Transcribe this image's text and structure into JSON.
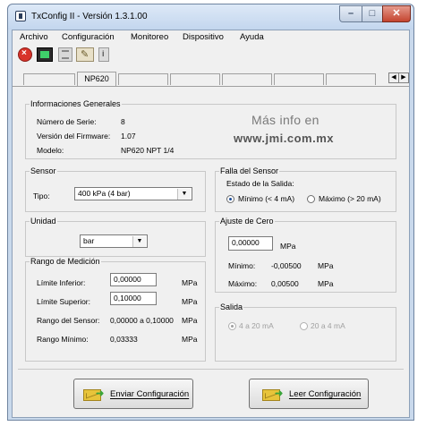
{
  "window": {
    "title": "TxConfig II - Versión 1.3.1.00"
  },
  "menu": [
    "Archivo",
    "Configuración",
    "Monitoreo",
    "Dispositivo",
    "Ayuda"
  ],
  "tabs": {
    "active": "NP620"
  },
  "info": {
    "group": "Informaciones Generales",
    "serial_label": "Número de Serie:",
    "serial": "8",
    "firmware_label": "Versión del Firmware:",
    "firmware": "1.07",
    "model_label": "Modelo:",
    "model": "NP620 NPT 1/4",
    "promo_line1": "Más info en",
    "promo_line2": "www.jmi.com.mx"
  },
  "sensor": {
    "group": "Sensor",
    "type_label": "Tipo:",
    "type_value": "400 kPa (4 bar)"
  },
  "fault": {
    "group": "Falla del Sensor",
    "output_state_label": "Estado de la Salida:",
    "min_option": "Mínimo (< 4 mA)",
    "max_option": "Máximo (> 20 mA)",
    "selected": "min"
  },
  "unit": {
    "group": "Unidad",
    "value": "bar"
  },
  "zero": {
    "group": "Ajuste de Cero",
    "value": "0,00000",
    "unit": "MPa",
    "min_label": "Mínimo:",
    "min_value": "-0,00500",
    "min_unit": "MPa",
    "max_label": "Máximo:",
    "max_value": "0,00500",
    "max_unit": "MPa"
  },
  "range": {
    "group": "Rango de Medición",
    "lower_label": "Límite Inferior:",
    "lower_value": "0,00000",
    "lower_unit": "MPa",
    "upper_label": "Límite Superior:",
    "upper_value": "0,10000",
    "upper_unit": "MPa",
    "sensor_range_label": "Rango del Sensor:",
    "sensor_range_value": "0,00000 a 0,10000",
    "sensor_range_unit": "MPa",
    "min_range_label": "Rango Mínimo:",
    "min_range_value": "0,03333",
    "min_range_unit": "MPa"
  },
  "output": {
    "group": "Salida",
    "opt1": "4 a 20 mA",
    "opt2": "20 a 4 mA",
    "selected": "opt1"
  },
  "buttons": {
    "send": "Enviar Configuración",
    "read": "Leer Configuración"
  },
  "colors": {
    "accent_radio": "#1d4f9c",
    "close_button": "#c4452f",
    "envelope": "#e8c43a"
  }
}
